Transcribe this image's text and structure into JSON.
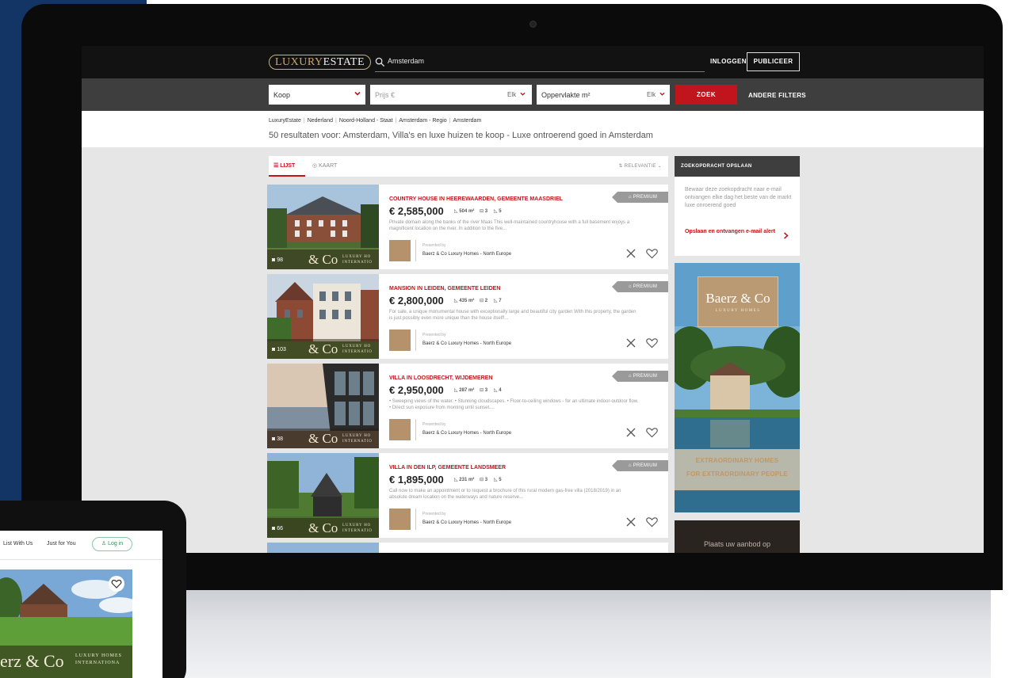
{
  "header": {
    "logo_part1": "LUXURY",
    "logo_part2": "ESTATE",
    "search_value": "Amsterdam",
    "login_label": "INLOGGEN",
    "publish_label": "PUBLICEER"
  },
  "filters": {
    "type_value": "Koop",
    "price_placeholder": "Prijs €",
    "price_value": "Elk",
    "area_placeholder": "Oppervlakte m²",
    "area_value": "Elk",
    "search_button": "ZOEK",
    "more_filters": "ANDERE FILTERS"
  },
  "breadcrumb": [
    "LuxuryEstate",
    "Nederland",
    "Noord-Holland - Staat",
    "Amsterdam - Regio",
    "Amsterdam"
  ],
  "results_text": "50 resultaten voor: Amsterdam, Villa's en luxe huizen te koop - Luxe ontroerend goed in Amsterdam",
  "view": {
    "list_label": "LIJST",
    "map_label": "KAART",
    "sort_label": "RELEVANTIE"
  },
  "listings": [
    {
      "title": "COUNTRY HOUSE IN HEEREWAARDEN, GEMEENTE MAASDRIEL",
      "price": "€ 2,585,000",
      "area": "504 m²",
      "beds": "3",
      "baths": "5",
      "desc": "Private domain along the banks of the river Maas This well-maintained countryhouse with a full basement enjoys a magnificent location on the river. In addition to the five...",
      "photos": "98",
      "badge": "PREMIUM",
      "presented": "Presented by",
      "agent": "Baerz & Co Luxury Homes - North Europe"
    },
    {
      "title": "MANSION IN LEIDEN, GEMEENTE LEIDEN",
      "price": "€ 2,800,000",
      "area": "435 m²",
      "beds": "2",
      "baths": "7",
      "desc": "For sale, a unique monumental house with exceptionally large and beautiful city garden With this property, the garden is just possibly even more unique than the house itself!...",
      "photos": "103",
      "badge": "PREMIUM",
      "presented": "Presented by",
      "agent": "Baerz & Co Luxury Homes - North Europe"
    },
    {
      "title": "VILLA IN LOOSDRECHT, WIJDEMEREN",
      "price": "€ 2,950,000",
      "area": "287 m²",
      "beds": "3",
      "baths": "4",
      "desc": "• Sweeping views of the water. • Stunning cloudscapes. • Floor-to-ceiling windows - for an ultimate indoor-outdoor flow. • Direct sun exposure from morning until sunset....",
      "photos": "38",
      "badge": "PREMIUM",
      "presented": "Presented by",
      "agent": "Baerz & Co Luxury Homes - North Europe"
    },
    {
      "title": "VILLA IN DEN ILP, GEMEENTE LANDSMEER",
      "price": "€ 1,895,000",
      "area": "231 m²",
      "beds": "3",
      "baths": "5",
      "desc": "Call now to make an appointment or to request a brochure of this rural modern gas-free villa (2018/2019) in an absolute dream location on the waterways and nature reserve...",
      "photos": "66",
      "badge": "PREMIUM",
      "presented": "Presented by",
      "agent": "Baerz & Co Luxury Homes - North Europe"
    }
  ],
  "photo_brand": {
    "main": "& Co",
    "small1": "LUXURY HO",
    "small2": "INTERNATIO"
  },
  "save_search": {
    "heading": "ZOEKOPDRACHT OPSLAAN",
    "text": "Bewaar deze zoekopdracht naar e-mail ontvangen elke dag het beste van de markt luxe onroerend goed",
    "link": "Opslaan en ontvangen e-mail alert"
  },
  "ad": {
    "brand": "Baerz & Co",
    "brand_sub": "LUXURY HOMES",
    "line1": "EXTRAORDINARY HOMES",
    "line2": "FOR EXTRAORDINARY PEOPLE"
  },
  "ad2_text": "Plaats uw aanbod op",
  "tablet": {
    "nav1": "List With Us",
    "nav2": "Just for You",
    "login": "Log in",
    "brand_main": "erz & Co",
    "brand_small1": "LUXURY HOMES",
    "brand_small2": "INTERNATIONA"
  },
  "colors": {
    "accent_red": "#c0151c",
    "navy_background": "#133566",
    "gold": "#c9a96a"
  }
}
